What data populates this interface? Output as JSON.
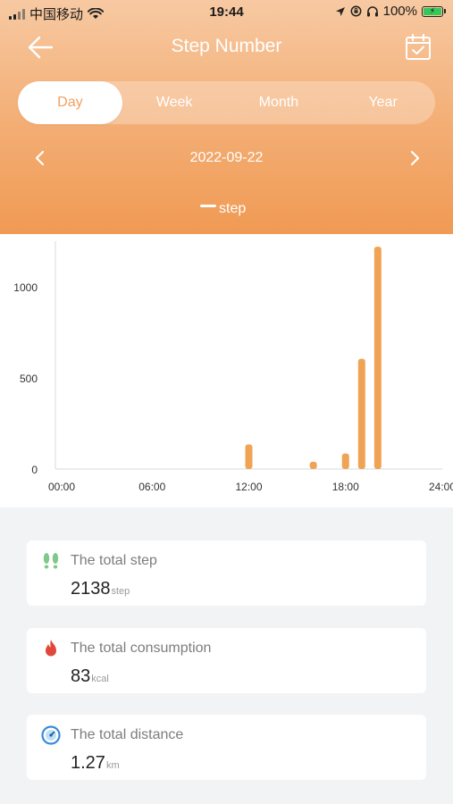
{
  "status_bar": {
    "carrier": "中国移动",
    "time": "19:44",
    "battery": "100%"
  },
  "nav": {
    "title": "Step Number"
  },
  "tabs": [
    {
      "label": "Day",
      "active": true
    },
    {
      "label": "Week",
      "active": false
    },
    {
      "label": "Month",
      "active": false
    },
    {
      "label": "Year",
      "active": false
    }
  ],
  "date": "2022-09-22",
  "legend": "step",
  "colors": {
    "accent": "#f0a05a",
    "bar": "#f0a355"
  },
  "chart_data": {
    "type": "bar",
    "x_tick_labels": [
      "00:00",
      "06:00",
      "12:00",
      "18:00",
      "24:00"
    ],
    "y_tick_labels": [
      "0",
      "500",
      "1000"
    ],
    "ylim": [
      0,
      1250
    ],
    "xlim": [
      0,
      24
    ],
    "series": [
      {
        "name": "step",
        "points": [
          {
            "hour": 12,
            "value": 135
          },
          {
            "hour": 16,
            "value": 40
          },
          {
            "hour": 18,
            "value": 85
          },
          {
            "hour": 19,
            "value": 605
          },
          {
            "hour": 20,
            "value": 1220
          }
        ]
      }
    ],
    "grid": false,
    "legend_position": "top-center"
  },
  "summary": {
    "total_step": {
      "label": "The total step",
      "value": "2138",
      "unit": "step"
    },
    "total_consumption": {
      "label": "The total consumption",
      "value": "83",
      "unit": "kcal"
    },
    "total_distance": {
      "label": "The total distance",
      "value": "1.27",
      "unit": "km"
    }
  }
}
